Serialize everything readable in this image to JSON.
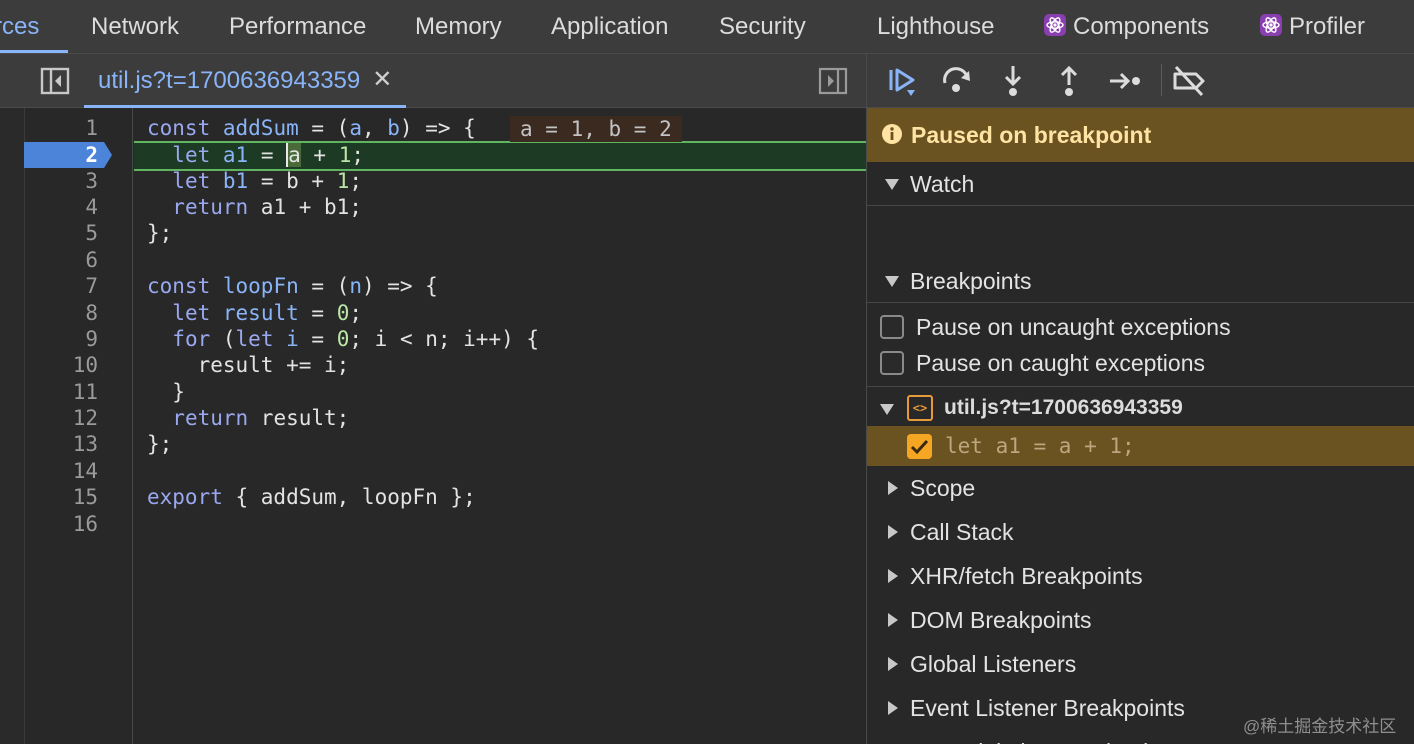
{
  "panel_tabs": [
    {
      "label": "rces",
      "active": true
    },
    {
      "label": "Network"
    },
    {
      "label": "Performance"
    },
    {
      "label": "Memory"
    },
    {
      "label": "Application"
    },
    {
      "label": "Security"
    },
    {
      "label": "Lighthouse"
    },
    {
      "label": "Components",
      "icon": "react-icon"
    },
    {
      "label": "Profiler",
      "icon": "react-icon"
    }
  ],
  "editor": {
    "file_tab": {
      "label": "util.js?t=1700636943359",
      "close": "✕"
    },
    "line_numbers": [
      "1",
      "2",
      "3",
      "4",
      "5",
      "6",
      "7",
      "8",
      "9",
      "10",
      "11",
      "12",
      "13",
      "14",
      "15",
      "16"
    ],
    "breakpoint_line": "2",
    "inline_values": "a = 1, b = 2",
    "lines": [
      "const addSum = (a, b) => {",
      "  let a1 = a + 1;",
      "  let b1 = b + 1;",
      "  return a1 + b1;",
      "};",
      "",
      "const loopFn = (n) => {",
      "  let result = 0;",
      "  for (let i = 0; i < n; i++) {",
      "    result += i;",
      "  }",
      "  return result;",
      "};",
      "",
      "export { addSum, loopFn };",
      ""
    ]
  },
  "debugger": {
    "toolbar": [
      "resume-icon",
      "step-over-icon",
      "step-into-icon",
      "step-out-icon",
      "step-icon",
      "deactivate-breakpoints-icon"
    ],
    "paused_message": "Paused on breakpoint",
    "watch_label": "Watch",
    "breakpoints_label": "Breakpoints",
    "pause_uncaught": "Pause on uncaught exceptions",
    "pause_caught": "Pause on caught exceptions",
    "bp_file": "util.js?t=1700636943359",
    "bp_code": "let a1 = a + 1;",
    "sections": [
      "Scope",
      "Call Stack",
      "XHR/fetch Breakpoints",
      "DOM Breakpoints",
      "Global Listeners",
      "Event Listener Breakpoints"
    ],
    "partial_section": "CSP Violation Breakpoints"
  },
  "watermark": "@稀土掘金技术社区",
  "colors": {
    "accent": "#8ab4f8",
    "paused_bg": "#6a5320",
    "exec_line": "#5fb560",
    "checkbox": "#f5a623"
  }
}
